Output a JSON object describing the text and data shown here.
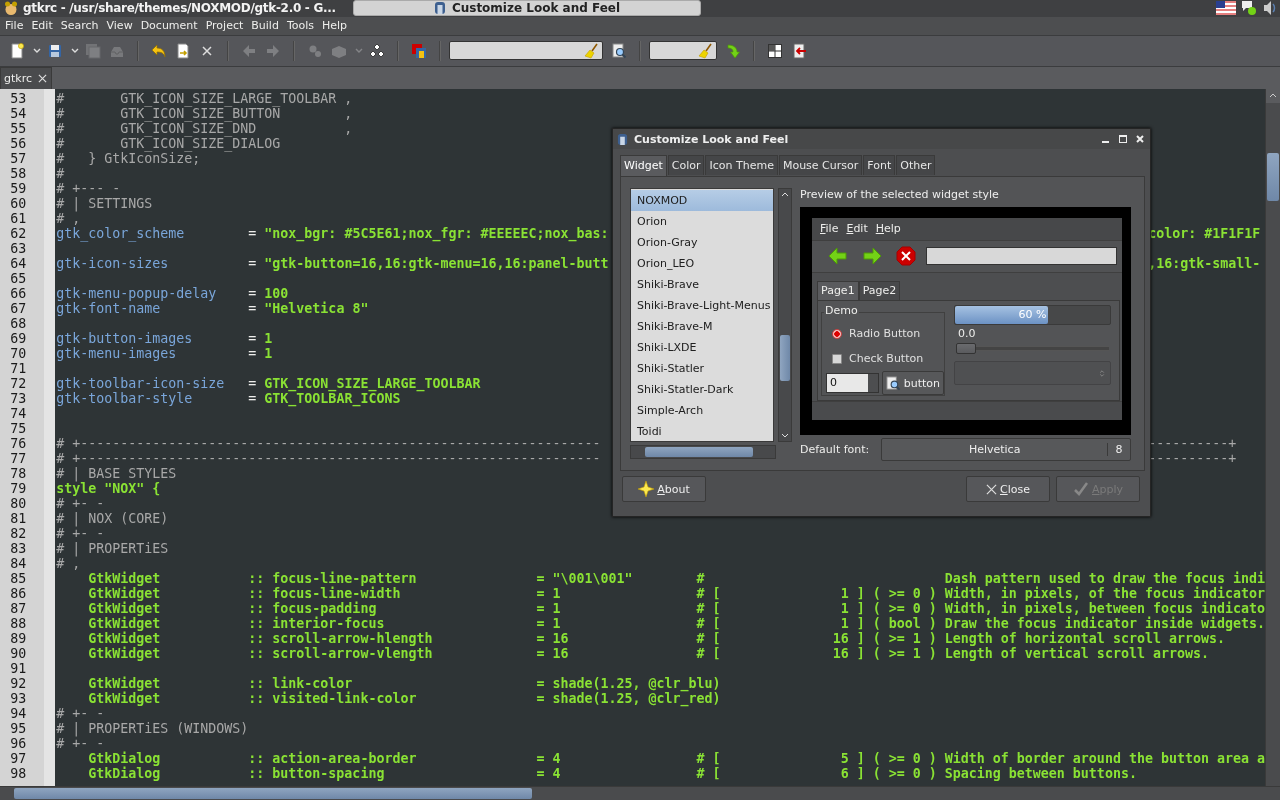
{
  "top_panel": {
    "window_title": "gtkrc - /usr/share/themes/NOXMOD/gtk-2.0 - G...",
    "task_button": "Customize Look and Feel"
  },
  "menu_bar": [
    "File",
    "Edit",
    "Search",
    "View",
    "Document",
    "Project",
    "Build",
    "Tools",
    "Help"
  ],
  "toolbar": [
    {
      "kind": "new",
      "disabled": false
    },
    {
      "kind": "caret",
      "disabled": false
    },
    {
      "kind": "save",
      "disabled": false
    },
    {
      "kind": "caret",
      "disabled": false
    },
    {
      "kind": "save-all",
      "disabled": true
    },
    {
      "kind": "tray",
      "disabled": true
    },
    {
      "kind": "sep"
    },
    {
      "kind": "undo",
      "disabled": false
    },
    {
      "kind": "reload",
      "disabled": false
    },
    {
      "kind": "close",
      "disabled": false
    },
    {
      "kind": "sep"
    },
    {
      "kind": "back",
      "disabled": true
    },
    {
      "kind": "forward",
      "disabled": true
    },
    {
      "kind": "sep"
    },
    {
      "kind": "gears",
      "disabled": true
    },
    {
      "kind": "brick",
      "disabled": true
    },
    {
      "kind": "caret",
      "disabled": true
    },
    {
      "kind": "run",
      "disabled": false
    },
    {
      "kind": "sep"
    },
    {
      "kind": "color",
      "disabled": false
    },
    {
      "kind": "sep"
    },
    {
      "kind": "search-field"
    },
    {
      "kind": "zoom",
      "disabled": false
    },
    {
      "kind": "sep"
    },
    {
      "kind": "line-field"
    },
    {
      "kind": "jump",
      "disabled": false
    },
    {
      "kind": "sep"
    },
    {
      "kind": "grid",
      "disabled": false
    },
    {
      "kind": "exit",
      "disabled": false
    }
  ],
  "editor": {
    "tab": "gtkrc",
    "lines": [
      {
        "n": "53",
        "segs": [
          {
            "kind": "comment",
            "text": "#       GTK_ICON_SIZE_LARGE_TOOLBAR ,"
          }
        ]
      },
      {
        "n": "54",
        "segs": [
          {
            "kind": "comment",
            "text": "#       GTK_ICON_SIZE_BUTTON        ,"
          }
        ]
      },
      {
        "n": "55",
        "segs": [
          {
            "kind": "comment",
            "text": "#       GTK_ICON_SIZE_DND           ,"
          }
        ]
      },
      {
        "n": "56",
        "segs": [
          {
            "kind": "comment",
            "text": "#       GTK_ICON_SIZE_DIALOG"
          }
        ]
      },
      {
        "n": "57",
        "segs": [
          {
            "kind": "comment",
            "text": "#   } GtkIconSize;"
          }
        ]
      },
      {
        "n": "58",
        "segs": [
          {
            "kind": "comment",
            "text": "#"
          }
        ]
      },
      {
        "n": "59",
        "segs": [
          {
            "kind": "comment",
            "text": "# +--- -"
          }
        ]
      },
      {
        "n": "60",
        "segs": [
          {
            "kind": "comment",
            "text": "# | SETTINGS"
          }
        ]
      },
      {
        "n": "61",
        "segs": [
          {
            "kind": "comment",
            "text": "# ,"
          }
        ]
      },
      {
        "n": "62",
        "segs": [
          {
            "kind": "key",
            "text": "gtk_color_scheme        "
          },
          {
            "kind": "op",
            "text": "= "
          },
          {
            "kind": "value",
            "text": "\"nox_bgr: #5C5E61;nox_fgr: #EEEEEC;nox_bas:"
          }
        ],
        "tail": {
          "kind": "value",
          "text": "color: #1F1F1F"
        }
      },
      {
        "n": "63"
      },
      {
        "n": "64",
        "segs": [
          {
            "kind": "key",
            "text": "gtk-icon-sizes          "
          },
          {
            "kind": "op",
            "text": "= "
          },
          {
            "kind": "value",
            "text": "\"gtk-button=16,16:gtk-menu=16,16:panel-butt"
          }
        ],
        "tail": {
          "kind": "value",
          "text": ",16:gtk-small-"
        }
      },
      {
        "n": "65"
      },
      {
        "n": "66",
        "segs": [
          {
            "kind": "key",
            "text": "gtk-menu-popup-delay    "
          },
          {
            "kind": "op",
            "text": "= "
          },
          {
            "kind": "value",
            "text": "100"
          }
        ]
      },
      {
        "n": "67",
        "segs": [
          {
            "kind": "key",
            "text": "gtk-font-name           "
          },
          {
            "kind": "op",
            "text": "= "
          },
          {
            "kind": "value",
            "text": "\"Helvetica 8\""
          }
        ]
      },
      {
        "n": "68"
      },
      {
        "n": "69",
        "segs": [
          {
            "kind": "key",
            "text": "gtk-button-images       "
          },
          {
            "kind": "op",
            "text": "= "
          },
          {
            "kind": "value",
            "text": "1"
          }
        ]
      },
      {
        "n": "70",
        "segs": [
          {
            "kind": "key",
            "text": "gtk-menu-images         "
          },
          {
            "kind": "op",
            "text": "= "
          },
          {
            "kind": "value",
            "text": "1"
          }
        ]
      },
      {
        "n": "71"
      },
      {
        "n": "72",
        "segs": [
          {
            "kind": "key",
            "text": "gtk-toolbar-icon-size   "
          },
          {
            "kind": "op",
            "text": "= "
          },
          {
            "kind": "value",
            "text": "GTK_ICON_SIZE_LARGE_TOOLBAR"
          }
        ]
      },
      {
        "n": "73",
        "segs": [
          {
            "kind": "key",
            "text": "gtk-toolbar-style       "
          },
          {
            "kind": "op",
            "text": "= "
          },
          {
            "kind": "value",
            "text": "GTK_TOOLBAR_ICONS"
          }
        ]
      },
      {
        "n": "74"
      },
      {
        "n": "75"
      },
      {
        "n": "76",
        "segs": [
          {
            "kind": "comment",
            "text": "# +-----------------------------------------------------------------"
          }
        ],
        "tail": {
          "kind": "comment",
          "text": "----------+"
        }
      },
      {
        "n": "77",
        "segs": [
          {
            "kind": "comment",
            "text": "# +-----------------------------------------------------------------"
          }
        ],
        "tail": {
          "kind": "comment",
          "text": "----------+"
        }
      },
      {
        "n": "78",
        "segs": [
          {
            "kind": "comment",
            "text": "# | BASE STYLES"
          }
        ]
      },
      {
        "n": "79",
        "segs": [
          {
            "kind": "value",
            "text": "style \"NOX\" {"
          }
        ]
      },
      {
        "n": "80",
        "segs": [
          {
            "kind": "comment",
            "text": "# +- -"
          }
        ]
      },
      {
        "n": "81",
        "segs": [
          {
            "kind": "comment",
            "text": "# | NOX (CORE)"
          }
        ]
      },
      {
        "n": "82",
        "segs": [
          {
            "kind": "comment",
            "text": "# +- -"
          }
        ]
      },
      {
        "n": "83",
        "segs": [
          {
            "kind": "comment",
            "text": "# | PROPERTiES"
          }
        ]
      },
      {
        "n": "84",
        "segs": [
          {
            "kind": "comment",
            "text": "# ,"
          }
        ]
      },
      {
        "n": "85",
        "segs": [
          {
            "kind": "value",
            "text": "    GtkWidget           :: focus-line-pattern               = \"\\001\\001\"        #                              Dash pattern used to draw the focus indi"
          }
        ]
      },
      {
        "n": "86",
        "segs": [
          {
            "kind": "value",
            "text": "    GtkWidget           :: focus-line-width                 = 1                 # [               1 ] ( >= 0 ) Width, in pixels, of the focus indicator"
          }
        ]
      },
      {
        "n": "87",
        "segs": [
          {
            "kind": "value",
            "text": "    GtkWidget           :: focus-padding                    = 1                 # [               1 ] ( >= 0 ) Width, in pixels, between focus indicato"
          }
        ]
      },
      {
        "n": "88",
        "segs": [
          {
            "kind": "value",
            "text": "    GtkWidget           :: interior-focus                   = 1                 # [               1 ] ( bool ) Draw the focus indicator inside widgets."
          }
        ]
      },
      {
        "n": "89",
        "segs": [
          {
            "kind": "value",
            "text": "    GtkWidget           :: scroll-arrow-hlength             = 16                # [              16 ] ( >= 1 ) Length of horizontal scroll arrows."
          }
        ]
      },
      {
        "n": "90",
        "segs": [
          {
            "kind": "value",
            "text": "    GtkWidget           :: scroll-arrow-vlength             = 16                # [              16 ] ( >= 1 ) Length of vertical scroll arrows."
          }
        ]
      },
      {
        "n": "91"
      },
      {
        "n": "92",
        "segs": [
          {
            "kind": "value",
            "text": "    GtkWidget           :: link-color                       = shade(1.25, @clr_blu)"
          }
        ]
      },
      {
        "n": "93",
        "segs": [
          {
            "kind": "value",
            "text": "    GtkWidget           :: visited-link-color               = shade(1.25, @clr_red)"
          }
        ]
      },
      {
        "n": "94",
        "segs": [
          {
            "kind": "comment",
            "text": "# +- -"
          }
        ]
      },
      {
        "n": "95",
        "segs": [
          {
            "kind": "comment",
            "text": "# | PROPERTiES (WINDOWS)"
          }
        ]
      },
      {
        "n": "96",
        "segs": [
          {
            "kind": "comment",
            "text": "# +- -"
          }
        ]
      },
      {
        "n": "97",
        "segs": [
          {
            "kind": "value",
            "text": "    GtkDialog           :: action-area-border               = 4                 # [               5 ] ( >= 0 ) Width of border around the button area a"
          }
        ]
      },
      {
        "n": "98",
        "segs": [
          {
            "kind": "value",
            "text": "    GtkDialog           :: button-spacing                   = 4                 # [               6 ] ( >= 0 ) Spacing between buttons."
          }
        ]
      }
    ]
  },
  "dialog": {
    "title": "Customize Look and Feel",
    "tabs": [
      {
        "label": "Widget",
        "selected": true
      },
      {
        "label": "Color",
        "selected": false
      },
      {
        "label": "Icon Theme",
        "selected": false
      },
      {
        "label": "Mouse Cursor",
        "selected": false
      },
      {
        "label": "Font",
        "selected": false
      },
      {
        "label": "Other",
        "selected": false
      }
    ],
    "styles": [
      {
        "label": "NOXMOD",
        "selected": true
      },
      {
        "label": "Orion",
        "selected": false
      },
      {
        "label": "Orion-Gray",
        "selected": false
      },
      {
        "label": "Orion_LEO",
        "selected": false
      },
      {
        "label": "Shiki-Brave",
        "selected": false
      },
      {
        "label": "Shiki-Brave-Light-Menus",
        "selected": false
      },
      {
        "label": "Shiki-Brave-M",
        "selected": false
      },
      {
        "label": "Shiki-LXDE",
        "selected": false
      },
      {
        "label": "Shiki-Statler",
        "selected": false
      },
      {
        "label": "Shiki-Statler-Dark",
        "selected": false
      },
      {
        "label": "Simple-Arch",
        "selected": false
      },
      {
        "label": "Toidi",
        "selected": false
      }
    ],
    "preview_label": "Preview of the selected widget style",
    "preview": {
      "menu": [
        "File",
        "Edit",
        "Help"
      ],
      "tabs": [
        {
          "label": "Page1",
          "selected": true
        },
        {
          "label": "Page2",
          "selected": false
        }
      ],
      "frame_label": "Demo",
      "radio": {
        "label": "Radio Button",
        "checked": true
      },
      "check": {
        "label": "Check Button",
        "checked": false
      },
      "spin_value": "0",
      "button": "button",
      "progress": {
        "level": 0.6,
        "text": "60 %"
      },
      "scale": {
        "reading": "0.0",
        "level": 0
      }
    },
    "default_font": {
      "label": "Default font:",
      "font": "Helvetica",
      "size": "8"
    },
    "buttons": [
      {
        "kind": "about",
        "label": "About",
        "disabled": false
      },
      {
        "kind": "close",
        "label": "Close",
        "disabled": false
      },
      {
        "kind": "apply",
        "label": "Apply",
        "disabled": true
      }
    ]
  }
}
